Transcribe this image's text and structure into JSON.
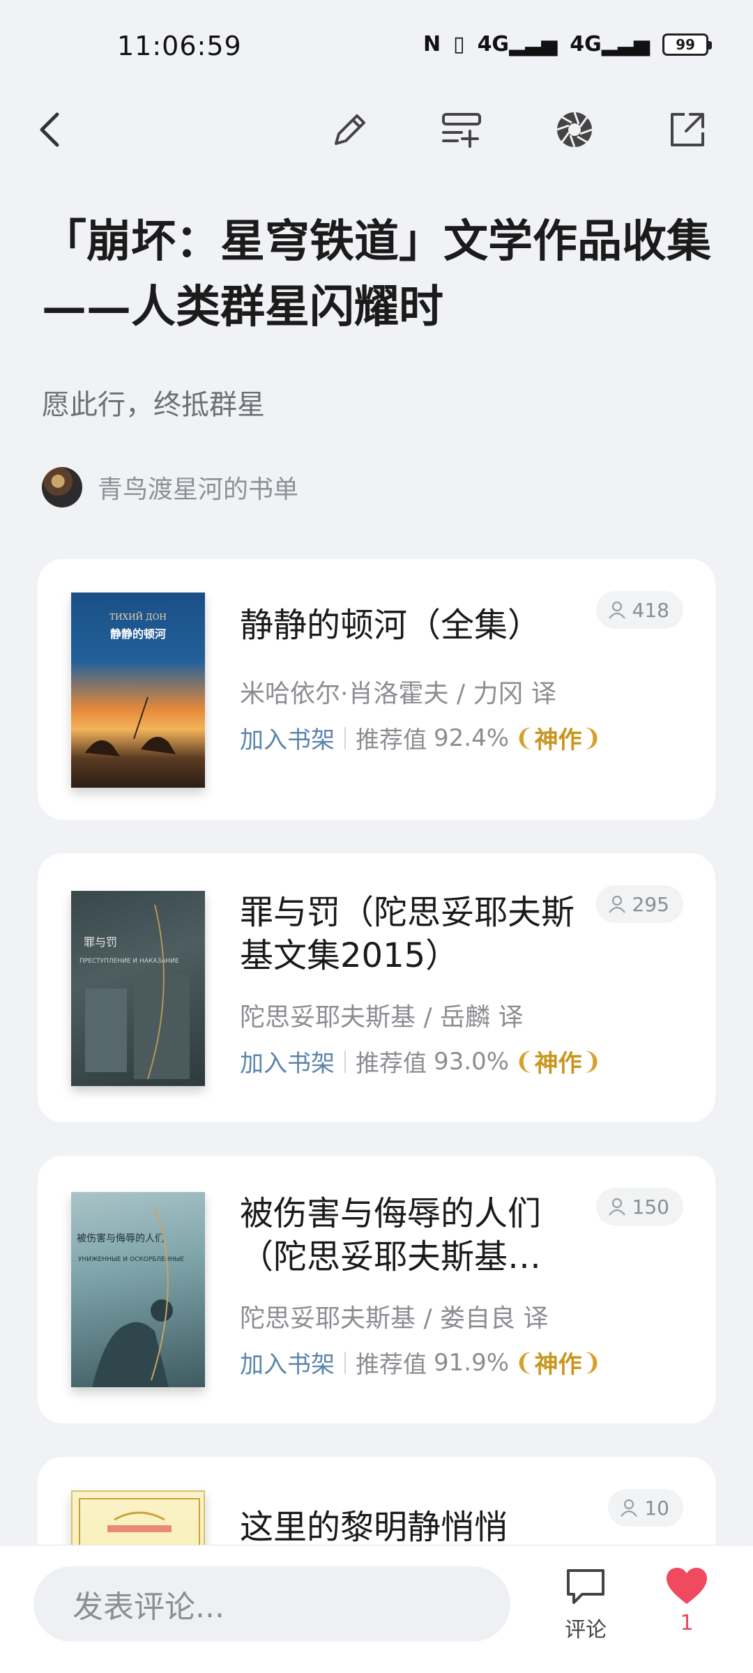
{
  "status": {
    "time": "11:06:59",
    "battery": "99",
    "nfc": "N",
    "network1": "4G",
    "network2": "4G"
  },
  "header": {
    "title": "「崩坏：星穹铁道」文学作品收集——人类群星闪耀时",
    "subtitle": "愿此行，终抵群星",
    "author": "青鸟渡星河的书单"
  },
  "books": [
    {
      "title": "静静的顿河（全集）",
      "author": "米哈依尔·肖洛霍夫 / 力冈 译",
      "add_label": "加入书架",
      "rec_label": "推荐值",
      "rec_value": "92.4%",
      "badge": "神作",
      "readers": "418",
      "cover": {
        "top_text": "ТИХИЙ ДОН",
        "cn_text": "静静的顿河"
      }
    },
    {
      "title": "罪与罚（陀思妥耶夫斯基文集2015）",
      "author": "陀思妥耶夫斯基 / 岳麟 译",
      "add_label": "加入书架",
      "rec_label": "推荐值",
      "rec_value": "93.0%",
      "badge": "神作",
      "readers": "295",
      "cover": {
        "cn_text": "罪与罚",
        "top_text": "ПРЕСТУПЛЕНИЕ И НАКАЗАНИЕ"
      }
    },
    {
      "title": "被伤害与侮辱的人们（陀思妥耶夫斯基…",
      "author": "陀思妥耶夫斯基 / 娄自良 译",
      "add_label": "加入书架",
      "rec_label": "推荐值",
      "rec_value": "91.9%",
      "badge": "神作",
      "readers": "150",
      "cover": {
        "cn_text": "被伤害与侮辱的人们",
        "top_text": "УНИЖЕННЫЕ И ОСКОРБЛЕННЫЕ"
      }
    },
    {
      "title": "这里的黎明静悄悄",
      "readers": "10"
    }
  ],
  "bottom": {
    "comment_placeholder": "发表评论...",
    "comment_label": "评论",
    "like_count": "1"
  },
  "colors": {
    "accent_link": "#5b84ad",
    "badge_gold": "#c8961f",
    "like_red": "#e8495b",
    "background": "#f1f2f5"
  }
}
